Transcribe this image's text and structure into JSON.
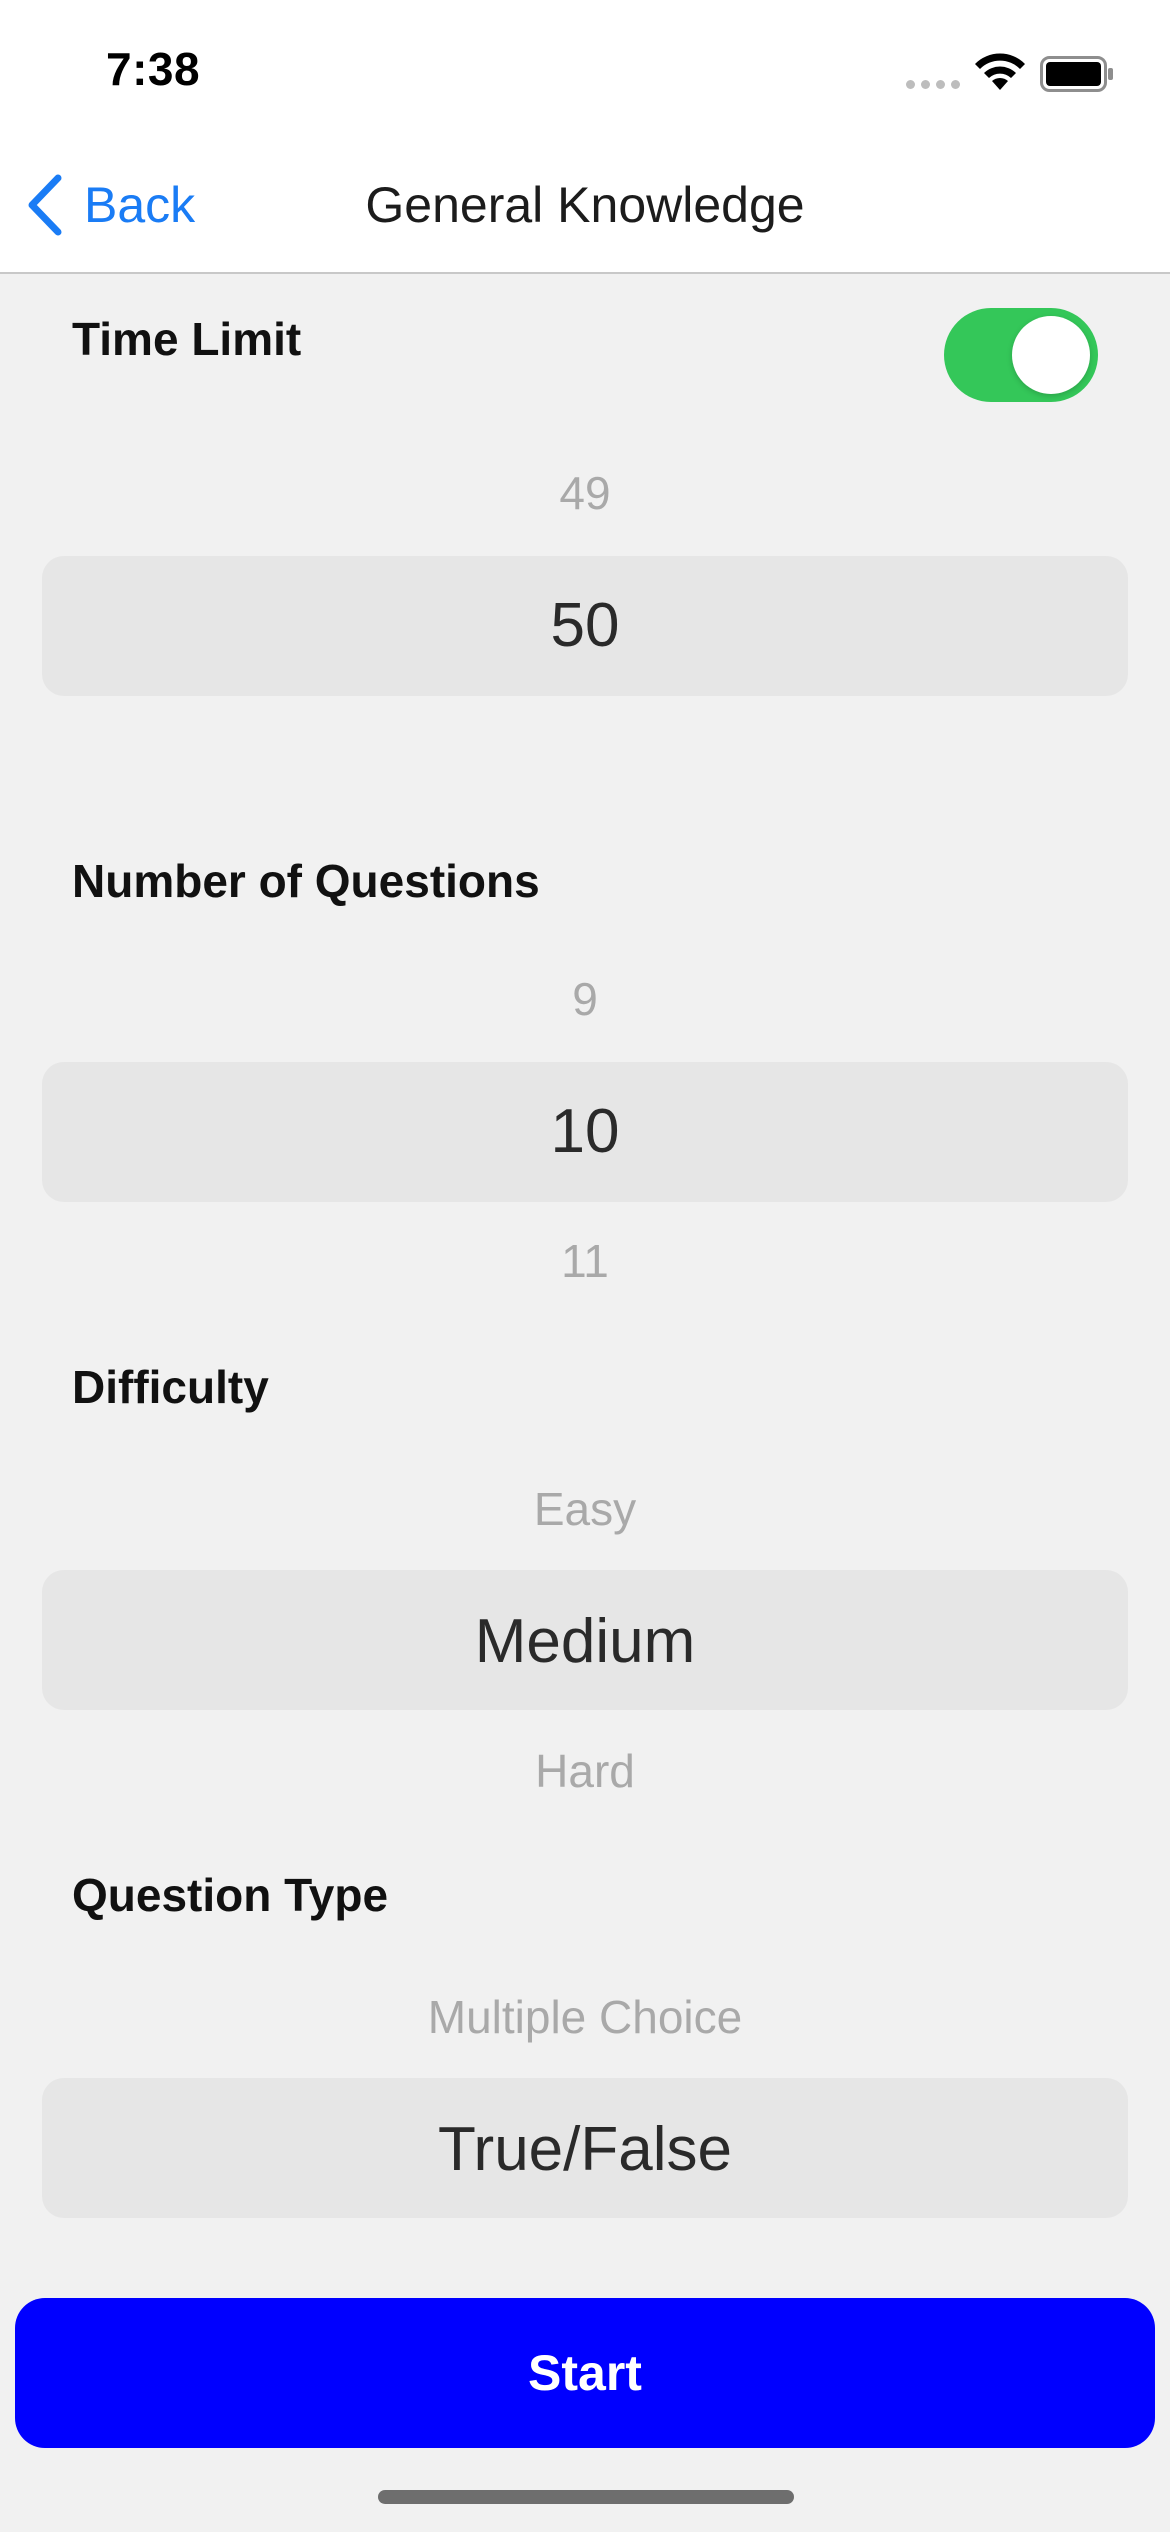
{
  "status_bar": {
    "time": "7:38",
    "signal_icon": "signal-dots-icon",
    "wifi_icon": "wifi-icon",
    "battery_icon": "battery-full-icon"
  },
  "nav": {
    "back_label": "Back",
    "title": "General Knowledge",
    "accent_color": "#1a7cf5"
  },
  "time_limit": {
    "label": "Time Limit",
    "enabled": true,
    "toggle_color": "#34c759",
    "picker": {
      "above": "49",
      "selected": "50"
    }
  },
  "number_of_questions": {
    "label": "Number of Questions",
    "picker": {
      "above": "9",
      "selected": "10",
      "below": "11"
    }
  },
  "difficulty": {
    "label": "Difficulty",
    "picker": {
      "above": "Easy",
      "selected": "Medium",
      "below": "Hard"
    }
  },
  "question_type": {
    "label": "Question Type",
    "picker": {
      "above": "Multiple Choice",
      "selected": "True/False"
    }
  },
  "start_button": {
    "label": "Start",
    "color": "#0000ff"
  }
}
